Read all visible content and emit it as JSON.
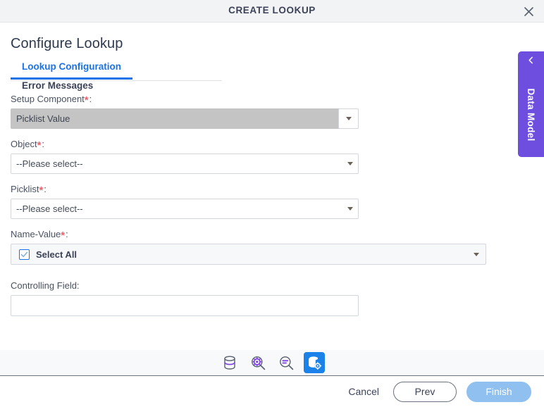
{
  "window": {
    "title": "CREATE LOOKUP",
    "close_icon": "close-icon"
  },
  "page": {
    "heading": "Configure Lookup"
  },
  "tabs": [
    {
      "label": "Lookup Configuration",
      "active": true
    },
    {
      "label": "Error Messages",
      "active": false
    }
  ],
  "form": {
    "setup_component": {
      "label": "Setup Component",
      "required_marker": "*",
      "colon": ":",
      "value": "Picklist Value",
      "disabled": true
    },
    "object": {
      "label": "Object",
      "required_marker": "*",
      "colon": ":",
      "value": "--Please select--"
    },
    "picklist": {
      "label": "Picklist",
      "required_marker": "*",
      "colon": ":",
      "value": "--Please select--"
    },
    "name_value": {
      "label": "Name-Value",
      "required_marker": "*",
      "colon": ":",
      "value": "Select All",
      "checked": true
    },
    "controlling_field": {
      "label": "Controlling Field:",
      "value": "",
      "placeholder": ""
    }
  },
  "toolbar": {
    "icons": [
      {
        "name": "database-icon",
        "title": "Database",
        "active": false
      },
      {
        "name": "search-gear-icon",
        "title": "Search Settings",
        "active": false
      },
      {
        "name": "search-list-icon",
        "title": "Search List",
        "active": false
      },
      {
        "name": "database-gear-icon",
        "title": "Database Settings",
        "active": true
      }
    ]
  },
  "footer": {
    "cancel_label": "Cancel",
    "prev_label": "Prev",
    "finish_label": "Finish"
  },
  "sidetab": {
    "label": "Data Model",
    "chevron_icon": "chevron-left-icon"
  },
  "colors": {
    "accent_blue": "#1a73e8",
    "toolbar_active_blue": "#1a82e8",
    "finish_blue": "#8fc0ef",
    "sidetab_purple": "#6d4ede",
    "required_red": "#e8636f",
    "icon_purple": "#7a3fe0",
    "icon_grey": "#5b6270",
    "disabled_grey": "#c4c4c4"
  }
}
